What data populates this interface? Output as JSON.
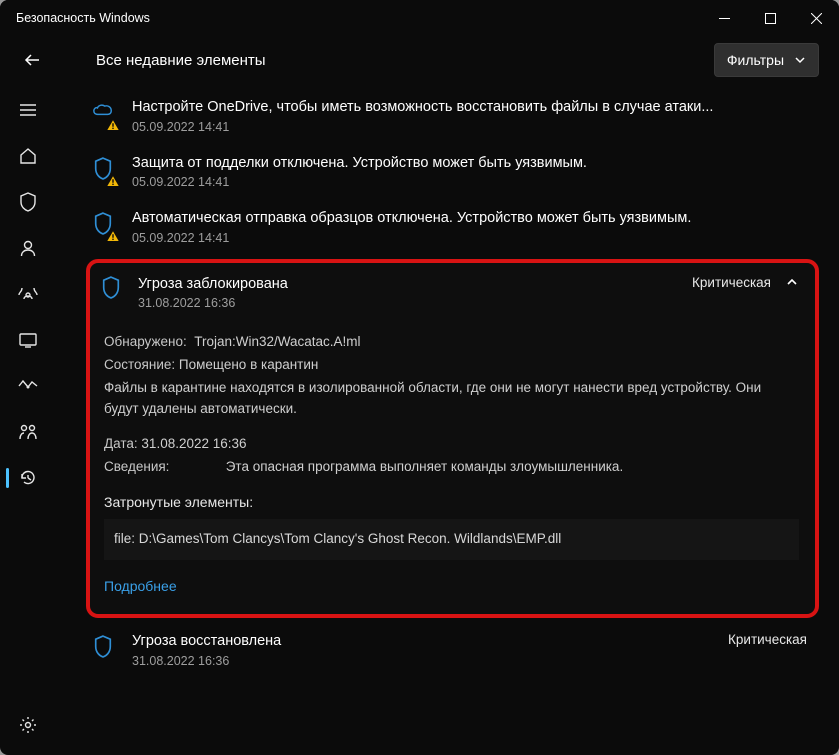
{
  "window": {
    "title": "Безопасность Windows"
  },
  "header": {
    "subtitle": "Все недавние элементы",
    "filter_label": "Фильтры"
  },
  "items": [
    {
      "title": "Настройте OneDrive, чтобы иметь возможность восстановить файлы в случае атаки...",
      "ts": "05.09.2022 14:41"
    },
    {
      "title": "Защита от подделки отключена. Устройство может быть уязвимым.",
      "ts": "05.09.2022 14:41"
    },
    {
      "title": "Автоматическая отправка образцов отключена. Устройство может быть уязвимым.",
      "ts": "05.09.2022 14:41"
    }
  ],
  "threat": {
    "title": "Угроза заблокирована",
    "ts": "31.08.2022 16:36",
    "severity": "Критическая",
    "detected_label": "Обнаружено:",
    "detected_value": "Trojan:Win32/Wacatac.A!ml",
    "state_label": "Состояние:",
    "state_value": "Помещено в карантин",
    "note": "Файлы в карантине находятся в изолированной области, где они не могут нанести вред устройству. Они будут удалены автоматически.",
    "date_label": "Дата:",
    "date_value": "31.08.2022 16:36",
    "info_label": "Сведения:",
    "info_value": "Эта опасная программа выполняет команды злоумышленника.",
    "affected_label": "Затронутые элементы:",
    "file": "file:  D:\\Games\\Tom Clancys\\Tom Clancy's Ghost Recon. Wildlands\\EMP.dll",
    "more": "Подробнее"
  },
  "restored": {
    "title": "Угроза восстановлена",
    "ts": "31.08.2022 16:36",
    "severity": "Критическая"
  }
}
